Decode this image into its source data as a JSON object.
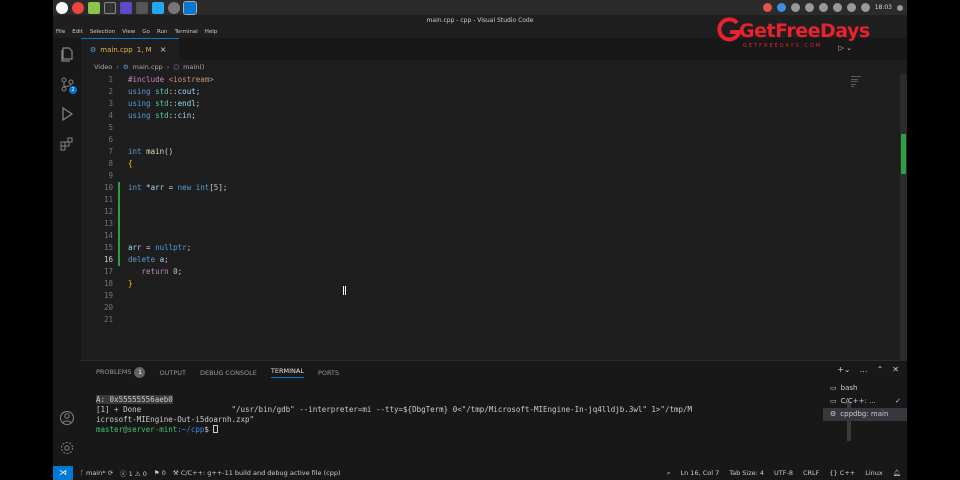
{
  "window_title": "main.cpp - cpp - Visual Studio Code",
  "clock": "18:03",
  "menu": [
    "File",
    "Edit",
    "Selection",
    "View",
    "Go",
    "Run",
    "Terminal",
    "Help"
  ],
  "tab": {
    "label": "main.cpp",
    "status": "1, M",
    "close": "×"
  },
  "breadcrumb": {
    "folder": "Video",
    "file": "main.cpp",
    "symbol": "main()"
  },
  "activity": {
    "scm_badge": "2"
  },
  "editor": {
    "line_numbers": [
      "1",
      "2",
      "3",
      "4",
      "5",
      "6",
      "7",
      "8",
      "9",
      "10",
      "11",
      "12",
      "13",
      "14",
      "15",
      "16",
      "17",
      "18",
      "19",
      "20",
      "21"
    ],
    "active_line": "16",
    "code": {
      "l1_directive": "#include",
      "l1_header": "<iostream>",
      "l2": [
        "using ",
        "std",
        "::",
        "cout",
        ";"
      ],
      "l3": [
        "using ",
        "std",
        "::",
        "endl",
        ";"
      ],
      "l4": [
        "using ",
        "std",
        "::",
        "cin",
        ";"
      ],
      "l7": [
        "int",
        " ",
        "main",
        "()"
      ],
      "l8": "{",
      "l10": [
        "int",
        " *",
        "arr",
        " = ",
        "new",
        " ",
        "int",
        "[",
        "5",
        "];"
      ],
      "l15": [
        "arr",
        " = ",
        "nullptr",
        ";"
      ],
      "l16": [
        "delete",
        " ",
        "a",
        ";"
      ],
      "l17": [
        "return",
        " ",
        "0",
        ";"
      ],
      "l18": "}"
    }
  },
  "panel": {
    "tabs": [
      "PROBLEMS",
      "OUTPUT",
      "DEBUG CONSOLE",
      "TERMINAL",
      "PORTS"
    ],
    "problems_count": "1",
    "active_tab": "TERMINAL",
    "terminal_lines": [
      "A: 0x55555556aeb0",
      "[1] + Done                    \"/usr/bin/gdb\" --interpreter=mi --tty=${DbgTerm} 0<\"/tmp/Microsoft-MIEngine-In-jq4lldjb.3wl\" 1>\"/tmp/M",
      "icrosoft-MIEngine-Out-i5doarnh.zxp\""
    ],
    "prompt_user": "master@server-mint",
    "prompt_path": ":~/cpp",
    "prompt_symbol": "$ ",
    "terminals": [
      "bash",
      "C/C++: ...",
      "cppdbg: main"
    ]
  },
  "status": {
    "branch": "main*",
    "errors": "1",
    "warnings": "0",
    "info": "0",
    "task": "C/C++: g++-11 build and debug active file (cpp)",
    "position": "Ln 16, Col 7",
    "tab_size": "Tab Size: 4",
    "encoding": "UTF-8",
    "eol": "CRLF",
    "language": "C++",
    "platform": "Linux"
  },
  "watermark": {
    "text": "GetFreeDays",
    "sub": "GETFREEDAYS.COM"
  },
  "colors": {
    "accent": "#0078d4",
    "keyword": "#569cd6",
    "modified": "#2ea043"
  }
}
